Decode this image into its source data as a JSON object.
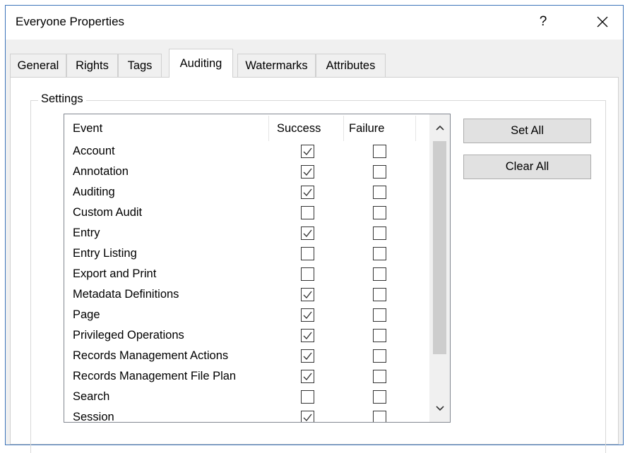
{
  "window": {
    "title": "Everyone Properties",
    "help_label": "?",
    "close_icon": "close-icon"
  },
  "tabs": [
    {
      "label": "General",
      "active": false
    },
    {
      "label": "Rights",
      "active": false
    },
    {
      "label": "Tags",
      "active": false
    },
    {
      "label": "Auditing",
      "active": true
    },
    {
      "label": "Watermarks",
      "active": false
    },
    {
      "label": "Attributes",
      "active": false
    }
  ],
  "settings": {
    "group_label": "Settings",
    "columns": {
      "event": "Event",
      "success": "Success",
      "failure": "Failure"
    },
    "rows": [
      {
        "event": "Account",
        "success": true,
        "failure": false
      },
      {
        "event": "Annotation",
        "success": true,
        "failure": false
      },
      {
        "event": "Auditing",
        "success": true,
        "failure": false
      },
      {
        "event": "Custom Audit",
        "success": false,
        "failure": false
      },
      {
        "event": "Entry",
        "success": true,
        "failure": false
      },
      {
        "event": "Entry Listing",
        "success": false,
        "failure": false
      },
      {
        "event": "Export and Print",
        "success": false,
        "failure": false
      },
      {
        "event": "Metadata Definitions",
        "success": true,
        "failure": false
      },
      {
        "event": "Page",
        "success": true,
        "failure": false
      },
      {
        "event": "Privileged Operations",
        "success": true,
        "failure": false
      },
      {
        "event": "Records Management Actions",
        "success": true,
        "failure": false
      },
      {
        "event": "Records Management File Plan",
        "success": true,
        "failure": false
      },
      {
        "event": "Search",
        "success": false,
        "failure": false
      },
      {
        "event": "Session",
        "success": true,
        "failure": false
      }
    ],
    "scrollbar": {
      "up_icon": "scroll-up-arrow-icon",
      "down_icon": "scroll-down-arrow-icon"
    }
  },
  "buttons": {
    "set_all": "Set All",
    "clear_all": "Clear All"
  }
}
